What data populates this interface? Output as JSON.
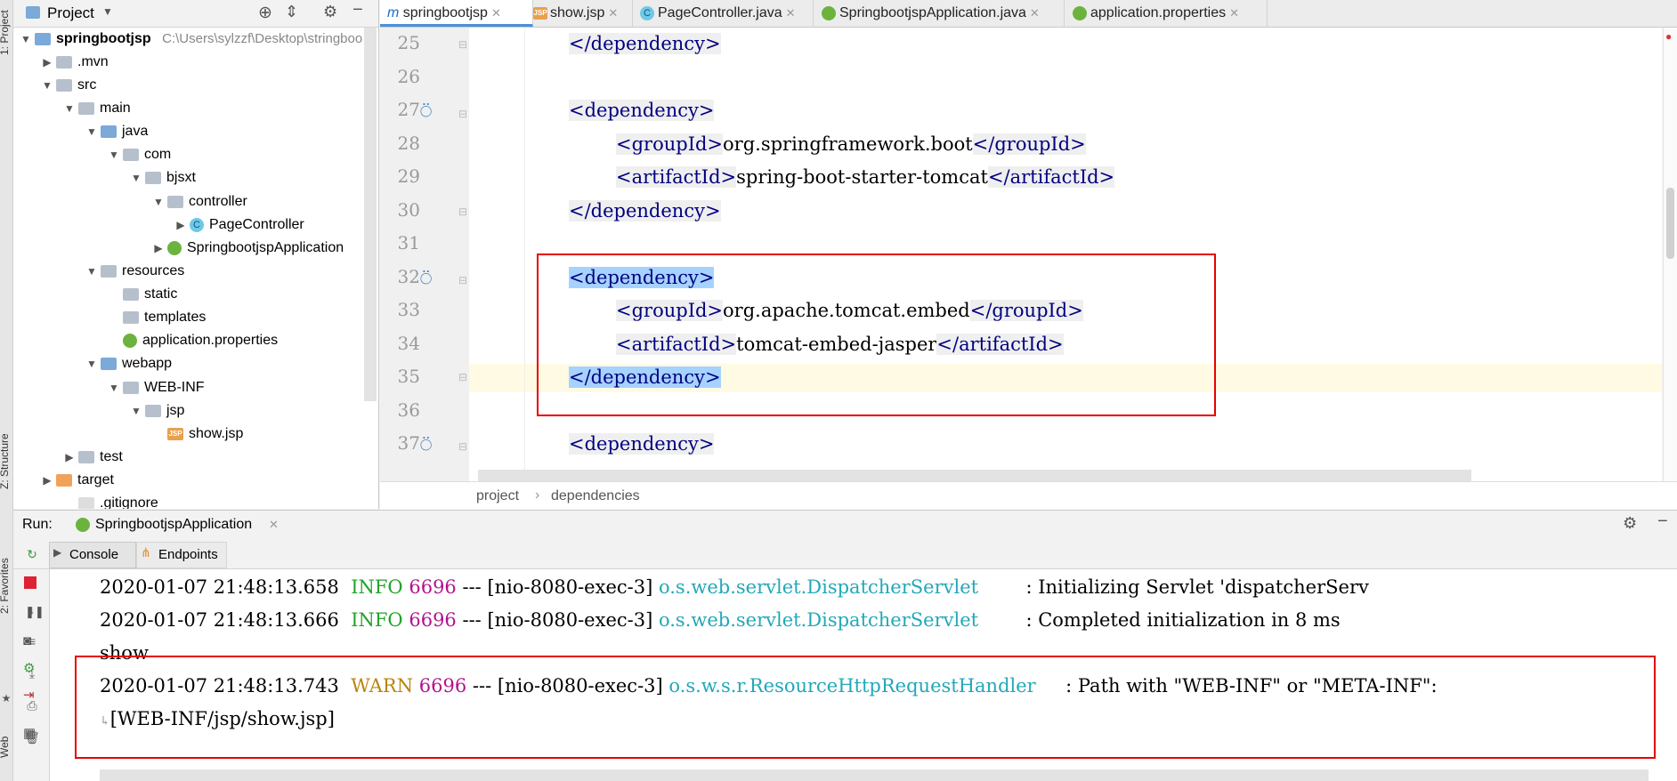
{
  "left_strip": {
    "project_tab": "1: Project",
    "structure_tab": "Z: Structure",
    "favorites_tab": "2: Favorites",
    "web_tab": "Web"
  },
  "project": {
    "title": "Project",
    "root_name": "springbootjsp",
    "root_path": "C:\\Users\\sylzzf\\Desktop\\stringboo",
    "nodes": {
      "mvn": ".mvn",
      "src": "src",
      "main": "main",
      "java": "java",
      "com": "com",
      "bjsxt": "bjsxt",
      "controller": "controller",
      "page_controller": "PageController",
      "app": "SpringbootjspApplication",
      "resources": "resources",
      "static": "static",
      "templates": "templates",
      "app_props": "application.properties",
      "webapp": "webapp",
      "webinf": "WEB-INF",
      "jsp": "jsp",
      "show_jsp": "show.jsp",
      "test": "test",
      "target": "target",
      "gitignore": ".gitignore"
    }
  },
  "editor": {
    "tabs": [
      "springbootjsp",
      "show.jsp",
      "PageController.java",
      "SpringbootjspApplication.java",
      "application.properties"
    ],
    "tab_prefix_m": "m",
    "tab_prefix_jsp": "JSP",
    "line_numbers": [
      "25",
      "26",
      "27",
      "28",
      "29",
      "30",
      "31",
      "32",
      "33",
      "34",
      "35",
      "36",
      "37"
    ],
    "lines": {
      "l25": "</dependency>",
      "l27": "<dependency>",
      "l28_open": "<groupId>",
      "l28_val": "org.springframework.boot",
      "l28_close": "</groupId>",
      "l29_open": "<artifactId>",
      "l29_val": "spring-boot-starter-tomcat",
      "l29_close": "</artifactId>",
      "l30": "</dependency>",
      "l32": "<dependency>",
      "l33_open": "<groupId>",
      "l33_val": "org.apache.tomcat.embed",
      "l33_close": "</groupId>",
      "l34_open": "<artifactId>",
      "l34_val": "tomcat-embed-jasper",
      "l34_close": "</artifactId>",
      "l35": "</dependency>",
      "l37": "<dependency>"
    },
    "breadcrumb": [
      "project",
      "dependencies"
    ],
    "breadcrumb_sep": "›"
  },
  "run": {
    "label": "Run:",
    "config": "SpringbootjspApplication",
    "tabs": [
      "Console",
      "Endpoints"
    ],
    "log": [
      {
        "ts": "2020-01-07 21:48:13.658",
        "level": "INFO",
        "pid": "6696",
        "sep": "---",
        "thread": "[nio-8080-exec-3]",
        "logger": "o.s.web.servlet.DispatcherServlet",
        "msg": ": Initializing Servlet 'dispatcherServ"
      },
      {
        "ts": "2020-01-07 21:48:13.666",
        "level": "INFO",
        "pid": "6696",
        "sep": "---",
        "thread": "[nio-8080-exec-3]",
        "logger": "o.s.web.servlet.DispatcherServlet",
        "msg": ": Completed initialization in 8 ms"
      },
      {
        "plain": "show"
      },
      {
        "ts": "2020-01-07 21:48:13.743",
        "level": "WARN",
        "pid": "6696",
        "sep": "---",
        "thread": "[nio-8080-exec-3]",
        "logger": "o.s.w.s.r.ResourceHttpRequestHandler",
        "msg": ": Path with \"WEB-INF\" or \"META-INF\":"
      },
      {
        "plain": "[WEB-INF/jsp/show.jsp]"
      }
    ]
  },
  "colors": {
    "accent": "#4a90d9",
    "highlight_box": "#e60000",
    "tag": "#000080",
    "info": "#21a32a",
    "warn": "#b8860b",
    "pid": "#b1138f",
    "logger": "#22a8b8"
  }
}
